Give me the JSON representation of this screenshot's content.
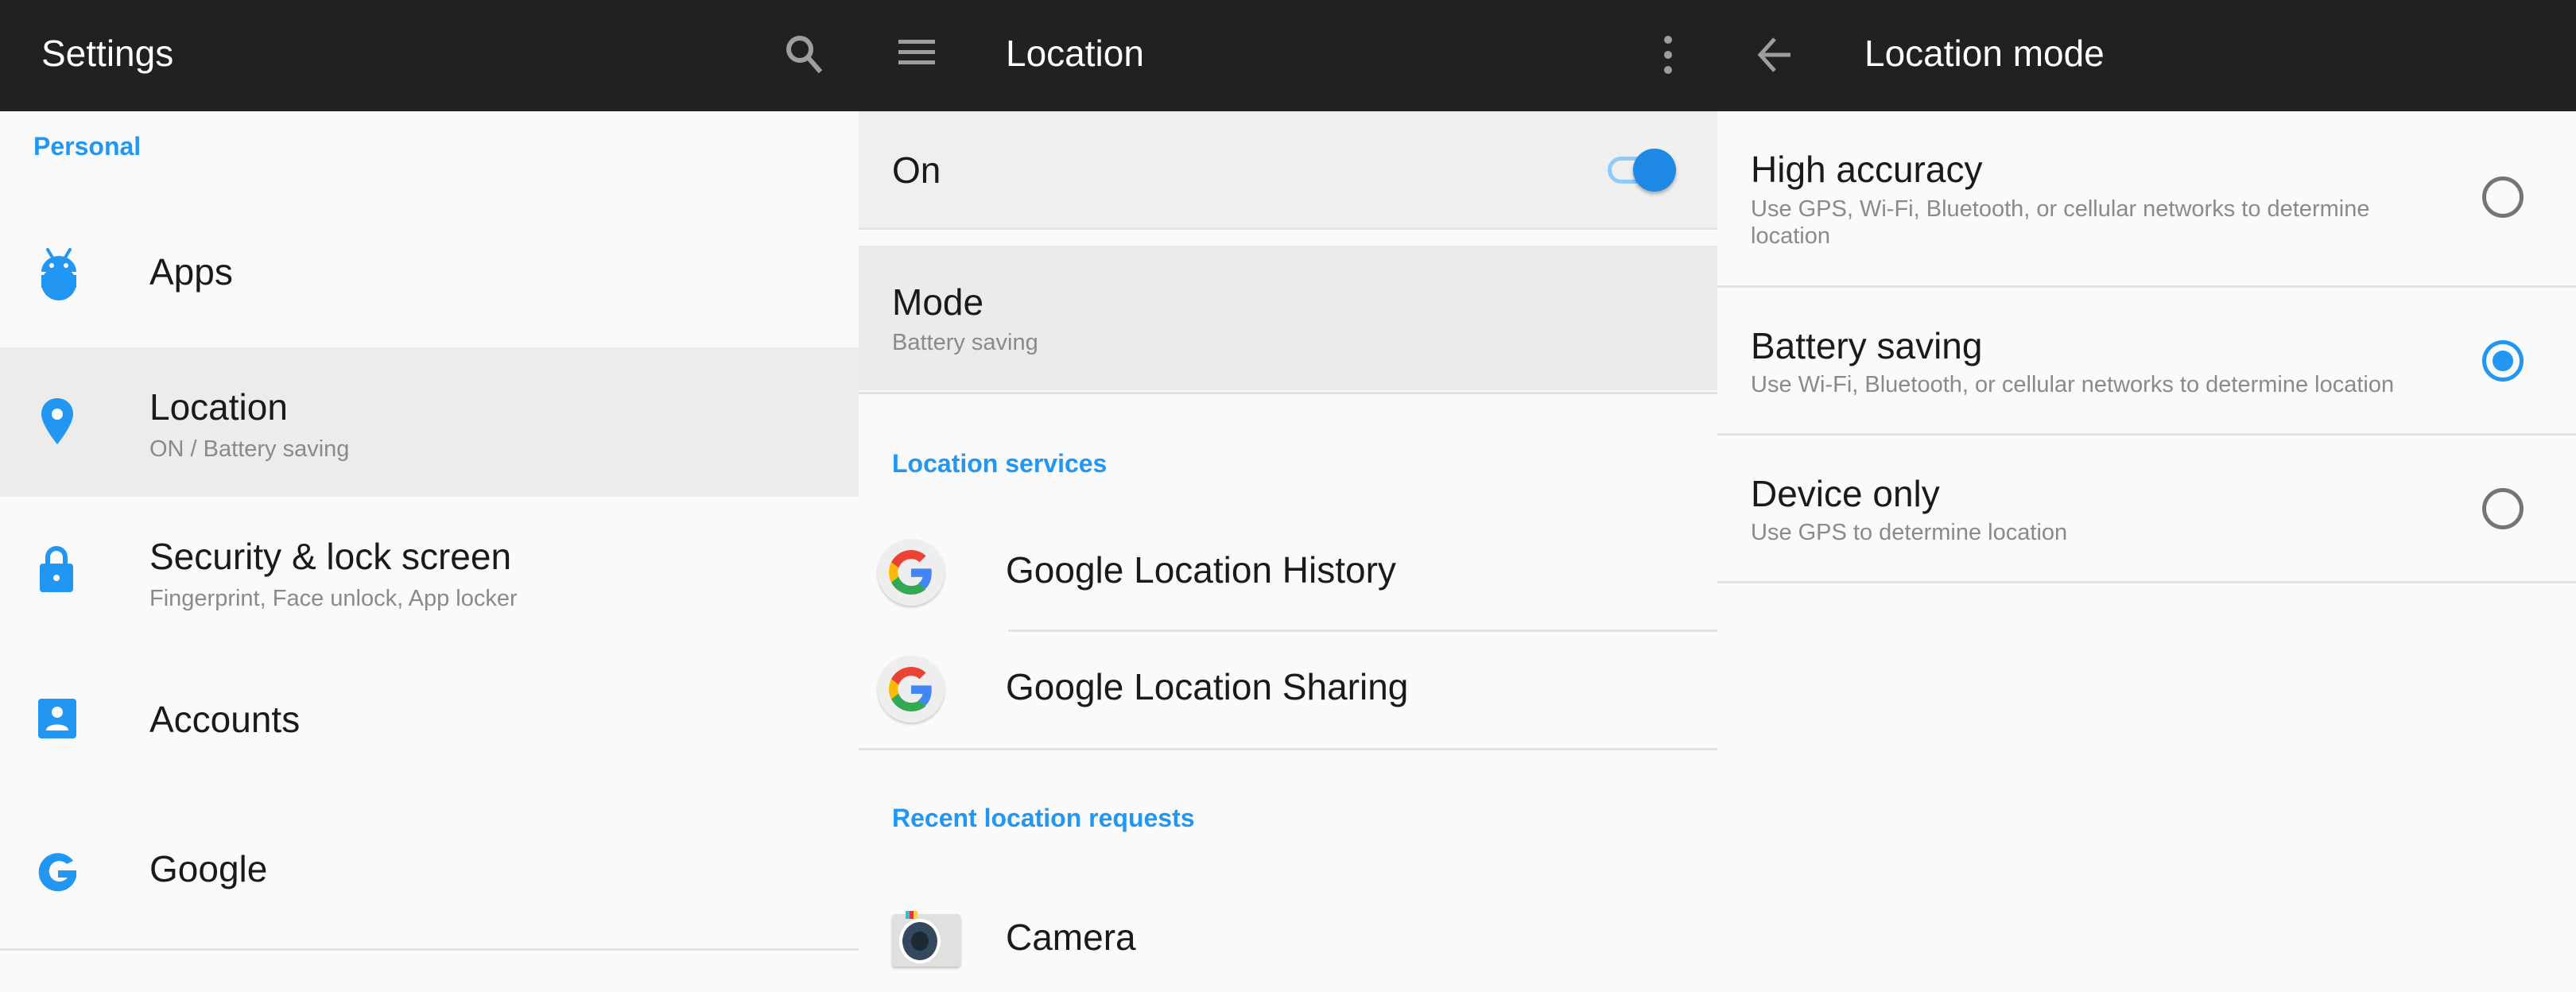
{
  "colors": {
    "appbar": "#212121",
    "accent": "#2196f3",
    "background": "#fafafa",
    "highlight": "#ececec"
  },
  "settings": {
    "title": "Settings",
    "search_icon": "search-icon",
    "section": "Personal",
    "items": [
      {
        "icon": "android-icon",
        "label": "Apps",
        "sub": ""
      },
      {
        "icon": "location-pin-icon",
        "label": "Location",
        "sub": "ON / Battery saving",
        "selected": true
      },
      {
        "icon": "lock-icon",
        "label": "Security & lock screen",
        "sub": "Fingerprint, Face unlock, App locker"
      },
      {
        "icon": "account-icon",
        "label": "Accounts",
        "sub": ""
      },
      {
        "icon": "google-icon",
        "label": "Google",
        "sub": ""
      }
    ]
  },
  "location": {
    "title": "Location",
    "menu_icon": "hamburger-menu-icon",
    "overflow_icon": "more-vert-icon",
    "master_switch": {
      "label": "On",
      "checked": true
    },
    "mode": {
      "label": "Mode",
      "value": "Battery saving"
    },
    "services_header": "Location services",
    "services": [
      {
        "icon": "google-g-color-icon",
        "label": "Google Location History"
      },
      {
        "icon": "google-g-color-icon",
        "label": "Google Location Sharing"
      }
    ],
    "recent_header": "Recent location requests",
    "recent": [
      {
        "icon": "camera-app-icon",
        "label": "Camera"
      }
    ]
  },
  "location_mode": {
    "title": "Location mode",
    "back_icon": "arrow-back-icon",
    "options": [
      {
        "label": "High accuracy",
        "desc": "Use GPS, Wi-Fi, Bluetooth, or cellular networks to determine location",
        "selected": false
      },
      {
        "label": "Battery saving",
        "desc": "Use Wi-Fi, Bluetooth, or cellular networks to determine location",
        "selected": true
      },
      {
        "label": "Device only",
        "desc": "Use GPS to determine location",
        "selected": false
      }
    ]
  }
}
